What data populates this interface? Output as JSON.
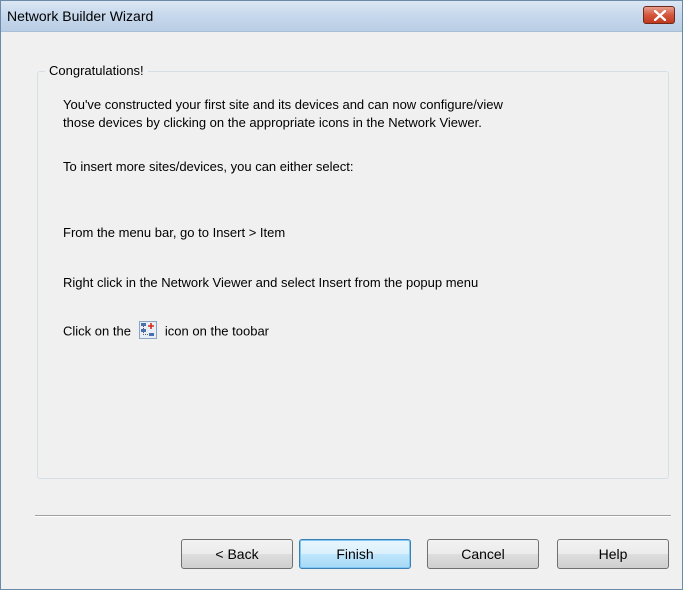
{
  "window": {
    "title": "Network Builder Wizard",
    "close_icon": "close-x-icon"
  },
  "group": {
    "legend": "Congratulations!"
  },
  "content": {
    "line1": "You've constructed your first site and its devices and can now configure/view",
    "line2": "those devices by clicking on the appropriate icons in the Network Viewer.",
    "line3": "To insert more sites/devices, you can either select:",
    "line4": "From the menu bar, go to Insert > Item",
    "line5": "Right click in the Network Viewer and select Insert from the popup menu",
    "line6_before": "Click on the",
    "line6_icon": "insert-item-icon",
    "line6_after": "icon on the toobar"
  },
  "buttons": {
    "back": "< Back",
    "finish": "Finish",
    "cancel": "Cancel",
    "help": "Help"
  },
  "colors": {
    "titlebar": "#c6d8ec",
    "close_button": "#c0391f",
    "default_button_border": "#3c7fb1"
  }
}
